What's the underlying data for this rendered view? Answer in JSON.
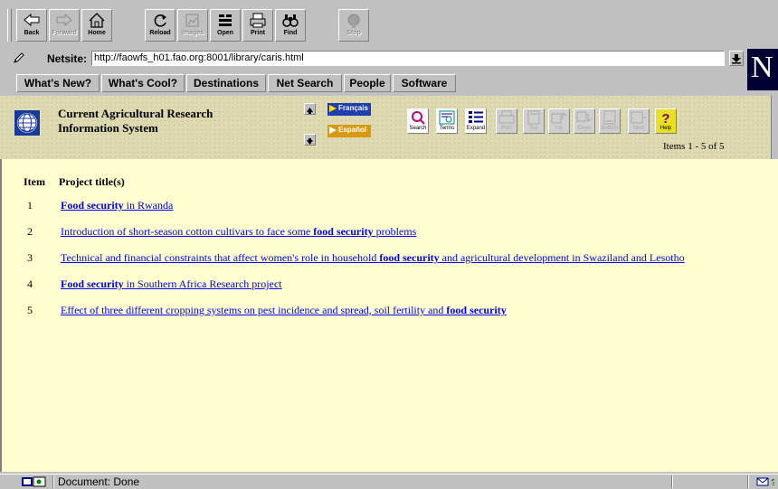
{
  "toolbar": {
    "buttons": [
      {
        "label": "Back",
        "icon": "back-arrow-icon",
        "enabled": true
      },
      {
        "label": "Forward",
        "icon": "forward-arrow-icon",
        "enabled": false
      },
      {
        "label": "Home",
        "icon": "home-icon",
        "enabled": true
      },
      {
        "label": "Reload",
        "icon": "reload-icon",
        "enabled": true
      },
      {
        "label": "Images",
        "icon": "images-icon",
        "enabled": false
      },
      {
        "label": "Open",
        "icon": "open-icon",
        "enabled": true
      },
      {
        "label": "Print",
        "icon": "print-icon",
        "enabled": true
      },
      {
        "label": "Find",
        "icon": "find-icon",
        "enabled": true
      },
      {
        "label": "Stop",
        "icon": "stop-icon",
        "enabled": false
      }
    ]
  },
  "location": {
    "label": "Netsite:",
    "url": "http://faowfs_h01.fao.org:8001/library/caris.html"
  },
  "directory_buttons": [
    "What's New?",
    "What's Cool?",
    "Destinations",
    "Net Search",
    "People",
    "Software"
  ],
  "site": {
    "title_line1": "Current Agricultural Research",
    "title_line2": "Information System",
    "lang_fr": "Français",
    "lang_es": "Español",
    "items_count": "Items 1 - 5 of 5"
  },
  "tools": [
    {
      "label": "Search",
      "icon": "search-magnifier-icon",
      "enabled": true
    },
    {
      "label": "Terms",
      "icon": "terms-icon",
      "enabled": true
    },
    {
      "label": "Expand",
      "icon": "expand-icon",
      "enabled": true
    },
    {
      "label": "Print",
      "icon": "print-icon",
      "enabled": false
    },
    {
      "label": "Top",
      "icon": "top-icon",
      "enabled": false
    },
    {
      "label": "Up",
      "icon": "up-icon",
      "enabled": false
    },
    {
      "label": "Down",
      "icon": "down-icon",
      "enabled": false
    },
    {
      "label": "Bottom",
      "icon": "bottom-icon",
      "enabled": false
    },
    {
      "label": "Next",
      "icon": "next-icon",
      "enabled": false
    },
    {
      "label": "Help",
      "icon": "help-icon",
      "enabled": true
    }
  ],
  "results": {
    "col_item": "Item",
    "col_title": "Project title(s)",
    "rows": [
      {
        "num": "1",
        "parts": [
          {
            "t": "Food",
            "b": true
          },
          {
            "t": " ",
            "b": false
          },
          {
            "t": "security",
            "b": true
          },
          {
            "t": " in Rwanda",
            "b": false
          }
        ]
      },
      {
        "num": "2",
        "parts": [
          {
            "t": "Introduction of short-season cotton cultivars to face some ",
            "b": false
          },
          {
            "t": "food",
            "b": true
          },
          {
            "t": " ",
            "b": false
          },
          {
            "t": "security",
            "b": true
          },
          {
            "t": " problems",
            "b": false
          }
        ]
      },
      {
        "num": "3",
        "parts": [
          {
            "t": "Technical and financial constraints that affect women's role in household ",
            "b": false
          },
          {
            "t": "food",
            "b": true
          },
          {
            "t": " ",
            "b": false
          },
          {
            "t": "security",
            "b": true
          },
          {
            "t": " and agricultural development in Swaziland and Lesotho",
            "b": false
          }
        ]
      },
      {
        "num": "4",
        "parts": [
          {
            "t": "Food",
            "b": true
          },
          {
            "t": " ",
            "b": false
          },
          {
            "t": "security",
            "b": true
          },
          {
            "t": " in Southern Africa Research project",
            "b": false
          }
        ]
      },
      {
        "num": "5",
        "parts": [
          {
            "t": "Effect of three different cropping systems on pest incidence and spread, soil fertility and ",
            "b": false
          },
          {
            "t": "food",
            "b": true
          },
          {
            "t": " ",
            "b": false
          },
          {
            "t": "security",
            "b": true
          }
        ]
      }
    ]
  },
  "status": {
    "text": "Document: Done"
  },
  "colors": {
    "chrome": "#c0c0c0",
    "results_bg": "#fefecf",
    "link": "#0000ff",
    "header_bg": "#ddd9b0"
  }
}
